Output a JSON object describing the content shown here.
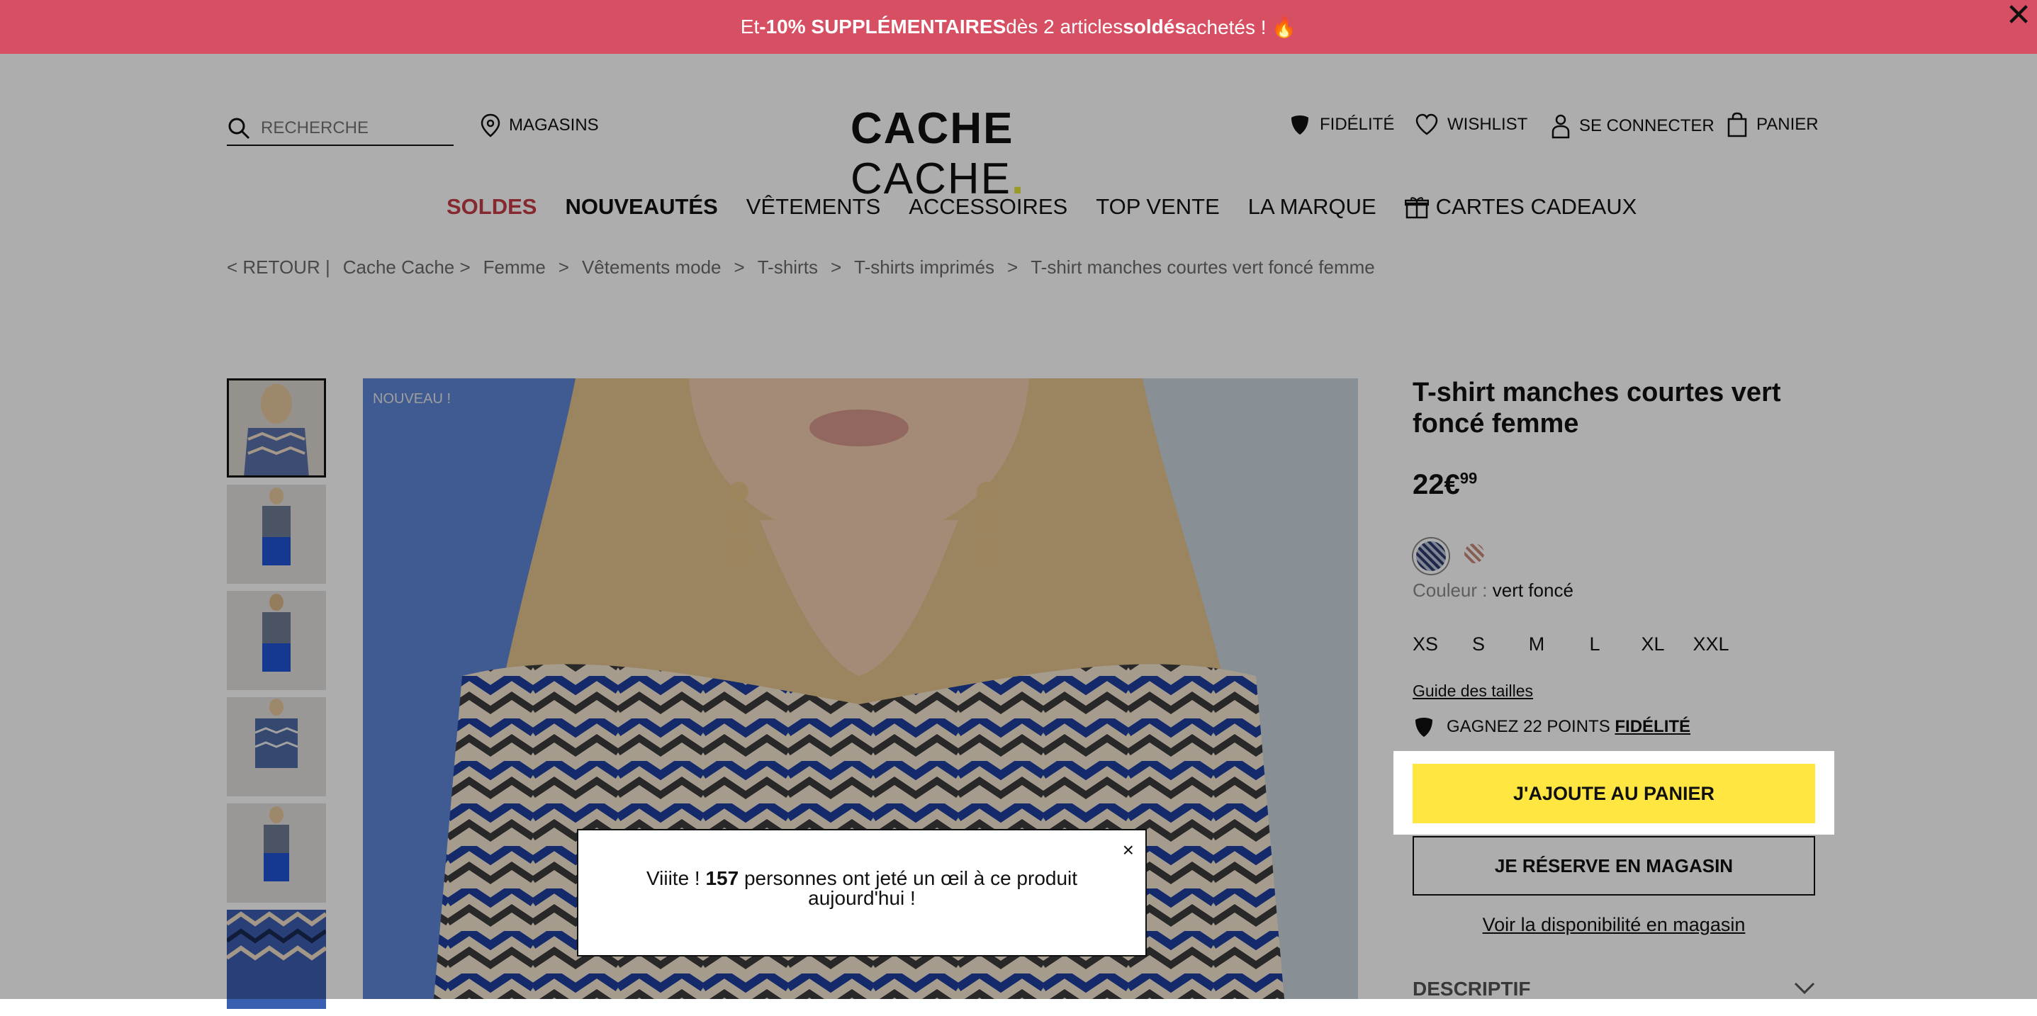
{
  "promo": {
    "prefix": "Et ",
    "bold1": "-10% SUPPLÉMENTAIRES",
    "mid": " dès 2 articles ",
    "bold2": "soldés",
    "suffix": " achetés ! 🔥",
    "close": "✕"
  },
  "search": {
    "placeholder": "RECHERCHE",
    "value": ""
  },
  "header": {
    "stores": "MAGASINS",
    "fidelite": "FIDÉLITÉ",
    "wishlist": "WISHLIST",
    "login": "SE CONNECTER",
    "cart": "PANIER"
  },
  "logo": {
    "part1": "CACHE",
    "part2": "CACHE",
    "dot": "."
  },
  "nav": [
    "SOLDES",
    "NOUVEAUTÉS",
    "VÊTEMENTS",
    "ACCESSOIRES",
    "TOP VENTE",
    "LA MARQUE",
    "CARTES CADEAUX"
  ],
  "breadcrumb": [
    "< RETOUR |",
    "Cache Cache >",
    "Femme",
    ">",
    "Vêtements mode",
    ">",
    "T-shirts",
    ">",
    "T-shirts imprimés",
    ">",
    "T-shirt manches courtes vert foncé femme"
  ],
  "product": {
    "badge": "NOUVEAU !",
    "title": "T-shirt manches courtes vert foncé femme",
    "price_main": "22€",
    "price_cents": "99",
    "color_label": "Couleur : ",
    "color_value": "vert foncé",
    "sizes": [
      "XS",
      "S",
      "M",
      "L",
      "XL",
      "XXL"
    ],
    "guide": "Guide des tailles",
    "points_text": "GAGNEZ 22 POINTS ",
    "points_link": "FIDÉLITÉ",
    "add_to_cart": "J'AJOUTE AU PANIER",
    "reserve": "JE RÉSERVE EN MAGASIN",
    "availability": "Voir la disponibilité en magasin",
    "descriptif": "DESCRIPTIF"
  },
  "popup": {
    "pre": "Viiite ! ",
    "count": "157",
    "post": " personnes ont jeté un œil à ce produit aujourd'hui !",
    "close": "×"
  },
  "colors": {
    "promo_bar": "#d74f63",
    "cta": "#ffe641",
    "sale": "#c43c48",
    "logo_dot": "#e4e13a"
  }
}
